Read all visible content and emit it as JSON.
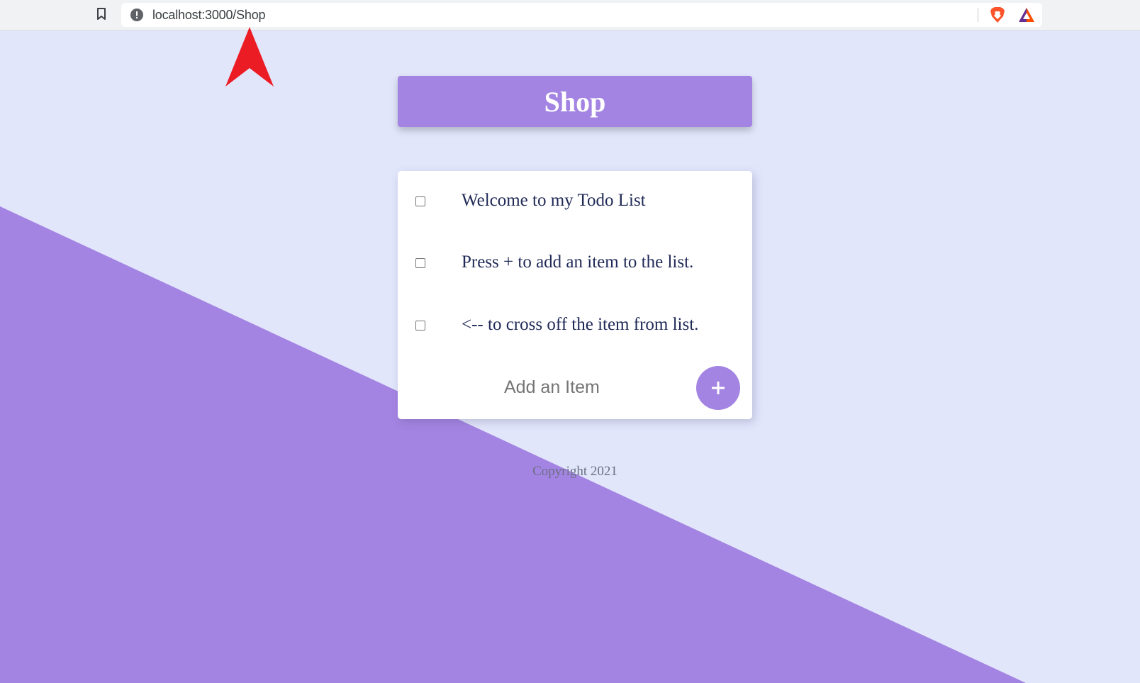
{
  "browser": {
    "url": "localhost:3000/Shop",
    "icons": [
      "bookmark-icon",
      "info-icon",
      "brave-icon",
      "bat-icon"
    ]
  },
  "header": {
    "title": "Shop"
  },
  "todo": {
    "items": [
      {
        "label": "Welcome to my Todo List",
        "checked": false
      },
      {
        "label": "Press + to add an item to the list.",
        "checked": false
      },
      {
        "label": "<-- to cross off the item from list.",
        "checked": false
      }
    ],
    "input_placeholder": "Add an Item",
    "add_button_icon": "plus-icon"
  },
  "footer": {
    "copyright": "Copyright 2021"
  },
  "colors": {
    "background": "#e2e6fb",
    "accent": "#a484e2",
    "item_text": "#1f2956",
    "annotation_arrow": "#ec1c24"
  }
}
